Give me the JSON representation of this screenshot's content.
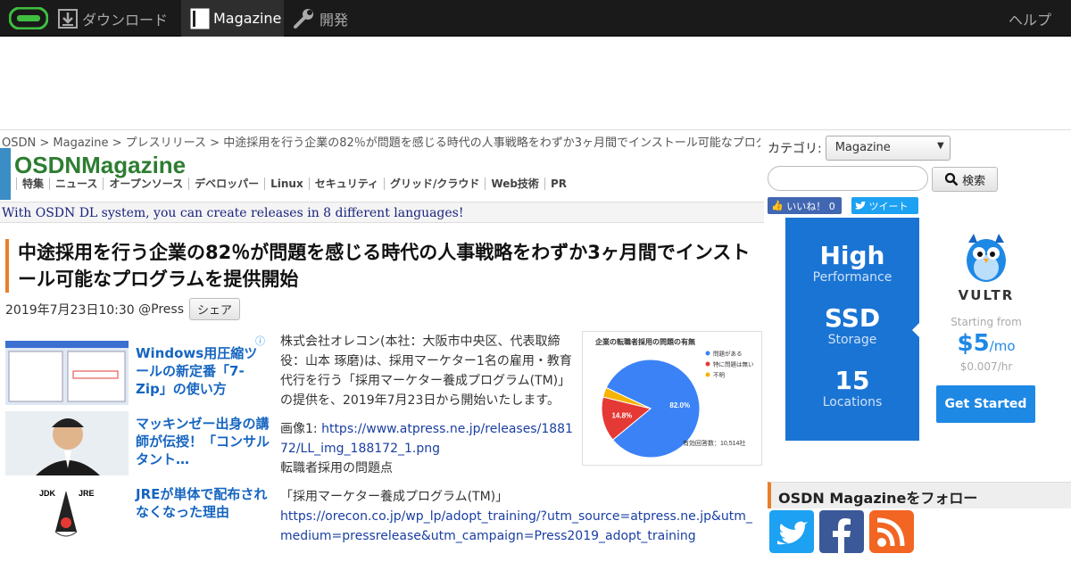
{
  "topbar": {
    "download_label": "ダウンロード",
    "magazine_label": "Magazine",
    "dev_label": "開発",
    "help_label": "ヘルプ"
  },
  "breadcrumb": {
    "items": [
      "OSDN",
      "Magazine",
      "プレスリリース",
      "中途採用を行う企業の82％が問題を感じる時代の人事戦略をわずか3ヶ月間でインストール可能なプログラ"
    ],
    "separator": " > "
  },
  "magazine": {
    "brand": "OSDNMagazine",
    "subnav": [
      "特集",
      "ニュース",
      "オープンソース",
      "デベロッパー",
      "Linux",
      "セキュリティ",
      "グリッド/クラウド",
      "Web技術",
      "PR"
    ]
  },
  "promo": "With OSDN DL system, you can create releases in 8 different languages!",
  "article": {
    "title": "中途採用を行う企業の82％が問題を感じる時代の人事戦略をわずか3ヶ月間でインストール可能なプログラムを提供開始",
    "date": "2019年7月23日10:30",
    "source": "@Press",
    "share_label": "シェア",
    "para1": "株式会社オレコン(本社：大阪市中央区、代表取締役：山本 琢磨)は、採用マーケター1名の雇用・教育代行を行う「採用マーケター養成プログラム(TM)」の提供を、2019年7月23日から開始いたします。",
    "image_label": "画像1: ",
    "image_url": "https://www.atpress.ne.jp/releases/188172/LL_img_188172_1.png",
    "image_caption": "転職者採用の問題点",
    "program_name": "「採用マーケター養成プログラム(TM)」",
    "program_url": "https://orecon.co.jp/wp_lp/adopt_training/?utm_source=atpress.ne.jp&utm_medium=pressrelease&utm_campaign=Press2019_adopt_training"
  },
  "related": [
    {
      "title": "Windows用圧縮ツールの新定番「7-Zip」の使い方"
    },
    {
      "title": "マッキンゼー出身の講師が伝授！「コンサルタント…"
    },
    {
      "title": "JREが単体で配布されなくなった理由"
    }
  ],
  "figure": {
    "title": "企業の転職者採用の問題の有無",
    "legend": [
      "問題がある",
      "特に問題は無い",
      "不明"
    ],
    "total": "有効回答数：10,514社",
    "colors": [
      "#3b82f6",
      "#e53935",
      "#f4b400"
    ]
  },
  "chart_data": {
    "type": "pie",
    "title": "企業の転職者採用の問題の有無",
    "categories": [
      "問題がある",
      "特に問題は無い",
      "不明"
    ],
    "values": [
      82.0,
      14.8,
      3.2
    ],
    "labels": [
      "82.0%",
      "14.8%"
    ]
  },
  "sidebar": {
    "category_label": "カテゴリ:",
    "category_value": "Magazine",
    "search_placeholder": "",
    "search_button": "検索",
    "like_label": "いいね！ 0",
    "tweet_label": "ツイート",
    "follow_title": "OSDN Magazineをフォロー"
  },
  "ad": {
    "specs": [
      {
        "big": "High",
        "small": "Performance"
      },
      {
        "big": "SSD",
        "small": "Storage"
      },
      {
        "big": "15",
        "small": "Locations"
      }
    ],
    "brand": "VULTR",
    "starting_from": "Starting from",
    "price": "$5",
    "per": "/mo",
    "hourly": "$0.007/hr",
    "cta": "Get Started"
  }
}
